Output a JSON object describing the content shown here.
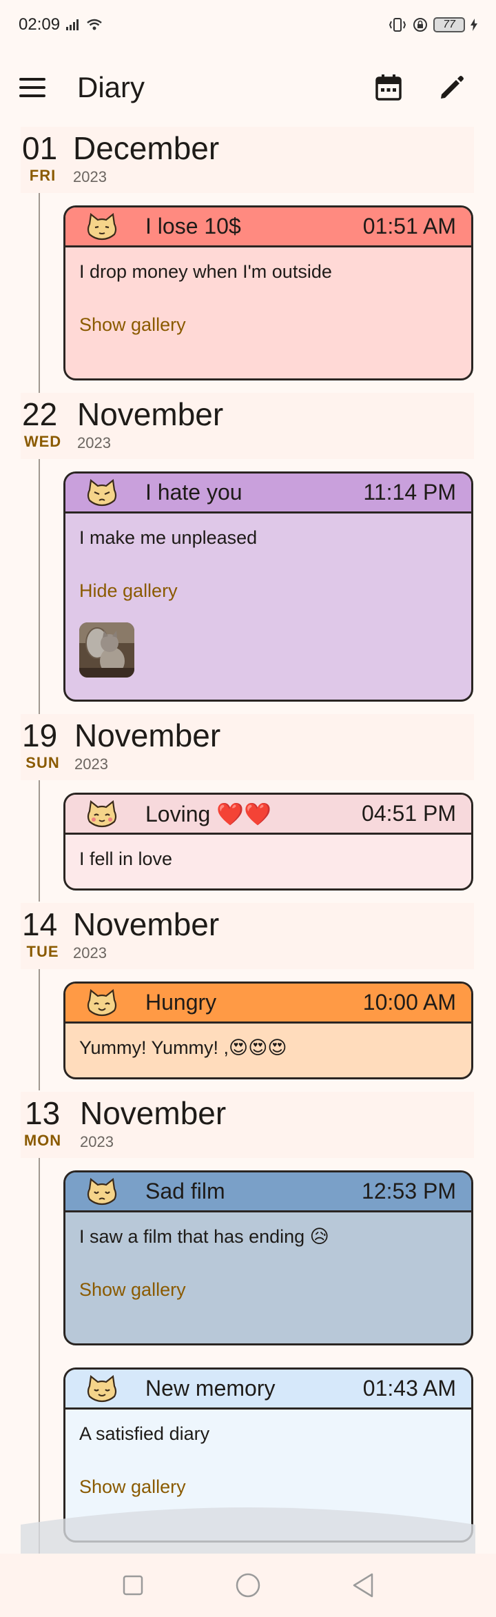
{
  "status_bar": {
    "time": "02:09",
    "battery": "77"
  },
  "app_bar": {
    "title": "Diary",
    "icons": [
      "menu-icon",
      "calendar-icon",
      "edit-icon"
    ]
  },
  "entries": [
    {
      "day": "01",
      "weekday": "FRI",
      "month": "December",
      "year": "2023",
      "cards": [
        {
          "title": "I lose 10$",
          "time": "01:51 AM",
          "text": "I drop money when I'm outside",
          "gallery": "Show gallery",
          "head_color": "#ff8a80",
          "body_color": "#ffd9d6"
        }
      ]
    },
    {
      "day": "22",
      "weekday": "WED",
      "month": "November",
      "year": "2023",
      "cards": [
        {
          "title": "I hate you",
          "time": "11:14 PM",
          "text": "I make me unpleased",
          "gallery": "Hide gallery",
          "head_color": "#c9a0dc",
          "body_color": "#dfc8e8"
        }
      ]
    },
    {
      "day": "19",
      "weekday": "SUN",
      "month": "November",
      "year": "2023",
      "cards": [
        {
          "title": "Loving ❤️❤️",
          "time": "04:51 PM",
          "text": "I fell in love",
          "head_color": "#f7d9dc",
          "body_color": "#fde9ea"
        }
      ]
    },
    {
      "day": "14",
      "weekday": "TUE",
      "month": "November",
      "year": "2023",
      "cards": [
        {
          "title": "Hungry",
          "time": "10:00 AM",
          "text": "Yummy! Yummy! ,😍😍😍",
          "head_color": "#ff9a45",
          "body_color": "#ffdcbc"
        }
      ]
    },
    {
      "day": "13",
      "weekday": "MON",
      "month": "November",
      "year": "2023",
      "cards": [
        {
          "title": "Sad film",
          "time": "12:53 PM",
          "text": "I saw a film that has ending 😥",
          "gallery": "Show gallery",
          "head_color": "#7aa0c8",
          "body_color": "#b8c8d8"
        },
        {
          "title": "New memory",
          "time": "01:43 AM",
          "text": "A satisfied diary",
          "gallery": "Show gallery",
          "head_color": "#d6e8fa",
          "body_color": "#eef6fd"
        }
      ]
    }
  ]
}
